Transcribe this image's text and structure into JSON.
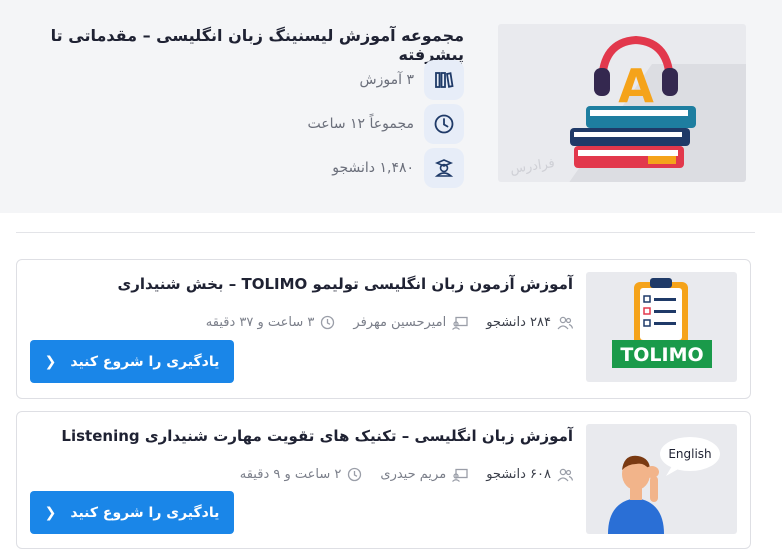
{
  "collection": {
    "title": "مجموعه آموزش لیسنینگ زبان انگلیسی – مقدماتی تا پیشرفته",
    "stats": {
      "courses": "۳ آموزش",
      "duration": "مجموعاً ۱۲ ساعت",
      "students": "۱,۴۸۰ دانشجو"
    },
    "hero_image": {
      "icon": "headphones-books-illustration",
      "letter": "A",
      "watermark": "فرادرس"
    }
  },
  "courses": [
    {
      "title": "آموزش آزمون زبان انگلیسی تولیمو TOLIMO – بخش شنیداری",
      "students": "۲۸۴ دانشجو",
      "instructor": "امیرحسین مهرفر",
      "duration": "۳ ساعت و ۳۷ دقیقه",
      "button": "یادگیری را شروع کنید",
      "thumb_label": "TOLIMO"
    },
    {
      "title": "آموزش زبان انگلیسی – تکنیک های تقویت مهارت شنیداری Listening",
      "students": "۶۰۸ دانشجو",
      "instructor": "مریم حیدری",
      "duration": "۲ ساعت و ۹ دقیقه",
      "button": "یادگیری را شروع کنید",
      "thumb_label": "English"
    }
  ],
  "colors": {
    "accent": "#1a86e8",
    "header_bg": "#f4f5f7",
    "icon_bg": "#e7edf8",
    "icon_fg": "#1f3a68"
  }
}
